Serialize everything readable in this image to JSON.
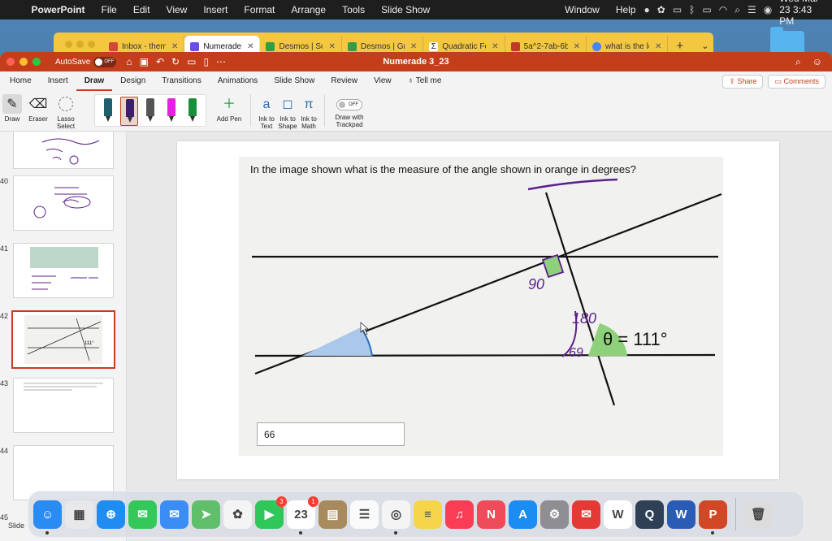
{
  "menubar": {
    "app_name": "PowerPoint",
    "items": [
      "File",
      "Edit",
      "View",
      "Insert",
      "Format",
      "Arrange",
      "Tools",
      "Slide Show"
    ],
    "window": "Window",
    "help": "Help",
    "clock": "Wed Mar 23  3:43 PM"
  },
  "browser": {
    "tabs": [
      {
        "label": "Inbox - theme",
        "color": "#d44638"
      },
      {
        "label": "Numerade",
        "color": "#6b4de6",
        "active": true
      },
      {
        "label": "Desmos | Sci",
        "color": "#2f9e44"
      },
      {
        "label": "Desmos | Gra",
        "color": "#2f9e44"
      },
      {
        "label": "Quadratic Fo",
        "color": "#222222"
      },
      {
        "label": "5a^2-7ab-6b",
        "color": "#c0392b"
      },
      {
        "label": "what is the le",
        "color": "#4285f4"
      }
    ]
  },
  "titlebar": {
    "autosave_label": "AutoSave",
    "autosave_state": "OFF",
    "doc_title": "Numerade 3_23"
  },
  "ribbon_tabs": [
    "Home",
    "Insert",
    "Draw",
    "Design",
    "Transitions",
    "Animations",
    "Slide Show",
    "Review",
    "View"
  ],
  "ribbon_active_tab": "Draw",
  "tell_me": "Tell me",
  "share_label": "Share",
  "comments_label": "Comments",
  "ribbon": {
    "draw": "Draw",
    "eraser": "Eraser",
    "lasso": "Lasso Select",
    "add_pen": "Add Pen",
    "ink_to_text": "Ink to Text",
    "ink_to_shape": "Ink to Shape",
    "ink_to_math": "Ink to Math",
    "trackpad_state": "OFF",
    "trackpad_label": "Draw with Trackpad",
    "pen_colors": [
      "#1f5f6e",
      "#3b1f6b",
      "#555555",
      "#e61ee6",
      "#1a8f3a"
    ]
  },
  "thumbnails": [
    {
      "num": ""
    },
    {
      "num": "40"
    },
    {
      "num": "41"
    },
    {
      "num": "42",
      "selected": true
    },
    {
      "num": "43"
    },
    {
      "num": "44"
    },
    {
      "num": "45"
    }
  ],
  "slide": {
    "question": "In the image shown what is the measure of the angle shown in orange in degrees?",
    "answer": "66",
    "annotations": {
      "right_angle": "90",
      "sum": "180",
      "theta_label": "θ = 111°",
      "sub": "69"
    }
  },
  "statusbar": "Slide",
  "colors": {
    "ppt_accent": "#c43e1c",
    "handwriting": "#5a1f8a",
    "angle_fill_blue": "#a9c8ea",
    "angle_fill_green": "#8fd07a"
  },
  "dock": [
    {
      "icon": "finder-icon",
      "color": "#2a8bf2"
    },
    {
      "icon": "launchpad-icon",
      "color": "#e8e8ea"
    },
    {
      "icon": "safari-icon",
      "color": "#1e8cf0"
    },
    {
      "icon": "messages-icon",
      "color": "#34c759"
    },
    {
      "icon": "mail-icon",
      "color": "#3b8df5"
    },
    {
      "icon": "maps-icon",
      "color": "#5fbf6a"
    },
    {
      "icon": "photos-icon",
      "color": "#f4f4f4"
    },
    {
      "icon": "facetime-icon",
      "color": "#2fc65a",
      "badge": "3"
    },
    {
      "icon": "calendar-icon",
      "color": "#ffffff",
      "badge": "1",
      "text": "23"
    },
    {
      "icon": "notes-brown-icon",
      "color": "#a88b5c"
    },
    {
      "icon": "reminders-icon",
      "color": "#fafafa"
    },
    {
      "icon": "chrome-icon",
      "color": "#f4f4f4"
    },
    {
      "icon": "notes-icon",
      "color": "#f7d54a"
    },
    {
      "icon": "music-icon",
      "color": "#fb3c55"
    },
    {
      "icon": "news-icon",
      "color": "#f04b5b"
    },
    {
      "icon": "appstore-icon",
      "color": "#1b8cf2"
    },
    {
      "icon": "settings-icon",
      "color": "#8e8e93"
    },
    {
      "icon": "airmail-icon",
      "color": "#e53935"
    },
    {
      "icon": "webex-icon",
      "color": "#ffffff",
      "text": "W"
    },
    {
      "icon": "quicktime-icon",
      "color": "#2f3f55"
    },
    {
      "icon": "word-icon",
      "color": "#2b5cb5"
    },
    {
      "icon": "powerpoint-icon",
      "color": "#d24726"
    },
    {
      "icon": "trash-icon",
      "color": "#dcdcdc"
    }
  ]
}
